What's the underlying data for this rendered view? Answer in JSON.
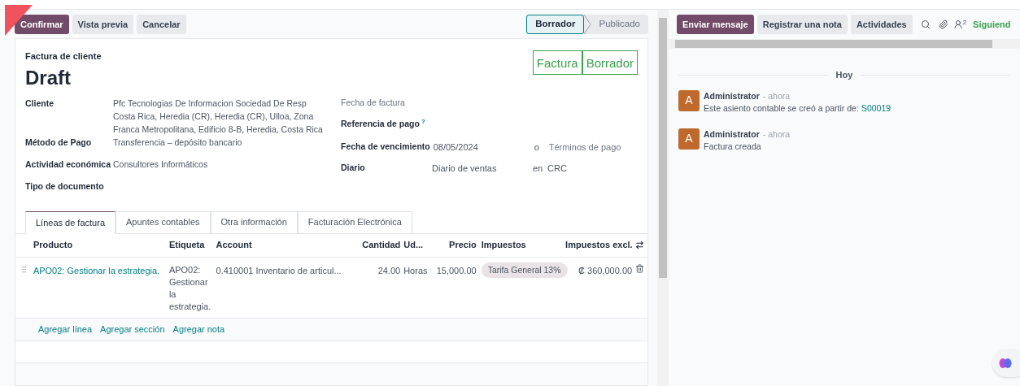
{
  "toolbar": {
    "buttons": [
      {
        "label": "Confirmar",
        "kind": "primary"
      },
      {
        "label": "Vista previa",
        "kind": "secondary"
      },
      {
        "label": "Cancelar",
        "kind": "secondary"
      }
    ]
  },
  "status_steps": [
    {
      "label": "Borrador",
      "selected": true
    },
    {
      "label": "Publicado",
      "selected": false
    }
  ],
  "invoice": {
    "type_label": "Factura de cliente",
    "name": "Draft",
    "ribbon": [
      "Factura",
      "Borrador"
    ],
    "fields_left": [
      {
        "label": "Cliente",
        "lines": [
          "Pfc Tecnologias De Informacion Sociedad De Resp",
          "Costa Rica, Heredia (CR), Heredia (CR), Ulloa, Zona",
          "Franca Metropolitana, Edificio 8-B, Heredia, Costa Rica"
        ]
      },
      {
        "label": "Método de Pago",
        "lines": [
          "Transferencia – depósito bancario"
        ]
      },
      {
        "label": "Actividad económica",
        "lines": [
          "Consultores Informáticos"
        ]
      },
      {
        "label": "Tipo de documento"
      }
    ],
    "fields_right": [
      {
        "label": "Fecha de factura",
        "muted": true
      },
      {
        "label": "Referencia de pago",
        "muted": false,
        "help_mark": "?"
      },
      {
        "label": "Fecha de vencimiento",
        "muted": false,
        "value": "08/05/2024",
        "connector": "o",
        "extra": "Términos de pago",
        "extra_placeholder": true
      },
      {
        "label": "Diario",
        "muted": false,
        "value": "Diario de ventas",
        "connector": "en",
        "extra": "CRC",
        "extra_placeholder": false
      }
    ]
  },
  "tabs": [
    {
      "label": "Líneas de factura",
      "selected": true
    },
    {
      "label": "Apuntes contables",
      "selected": false
    },
    {
      "label": "Otra información",
      "selected": false
    },
    {
      "label": "Facturación Electrónica",
      "selected": false
    }
  ],
  "table": {
    "columns": [
      "Producto",
      "Etiqueta",
      "Account",
      "Cantidad",
      "Ud...",
      "Precio",
      "Impuestos",
      "Impuestos excl."
    ],
    "rows": [
      {
        "product": "APO02: Gestionar la estrategia.",
        "label": [
          "APO02:",
          "Gestionar",
          "la",
          "estrategia."
        ],
        "account": "0.410001 Inventario de articul...",
        "quantity": "24.00",
        "uom": "Horas",
        "price": "15,000.00",
        "taxes": [
          "Tarifa General 13%"
        ],
        "subtotal": "₡ 360,000.00"
      }
    ],
    "add_links": [
      "Agregar línea",
      "Agregar sección",
      "Agregar nota"
    ]
  },
  "chatter": {
    "buttons": [
      {
        "label": "Enviar mensaje",
        "kind": "primary"
      },
      {
        "label": "Registrar una nota",
        "kind": "secondary"
      },
      {
        "label": "Actividades",
        "kind": "secondary"
      }
    ],
    "followers_count": "2",
    "follow_label": "Siguiend",
    "divider": "Hoy",
    "messages": [
      {
        "avatar": "A",
        "author": "Administrator",
        "time": "- ahora",
        "text": "Este asiento contable se creó a partir de:",
        "link": "S00019"
      },
      {
        "avatar": "A",
        "author": "Administrator",
        "time": "- ahora",
        "text": "Factura creada"
      }
    ]
  }
}
